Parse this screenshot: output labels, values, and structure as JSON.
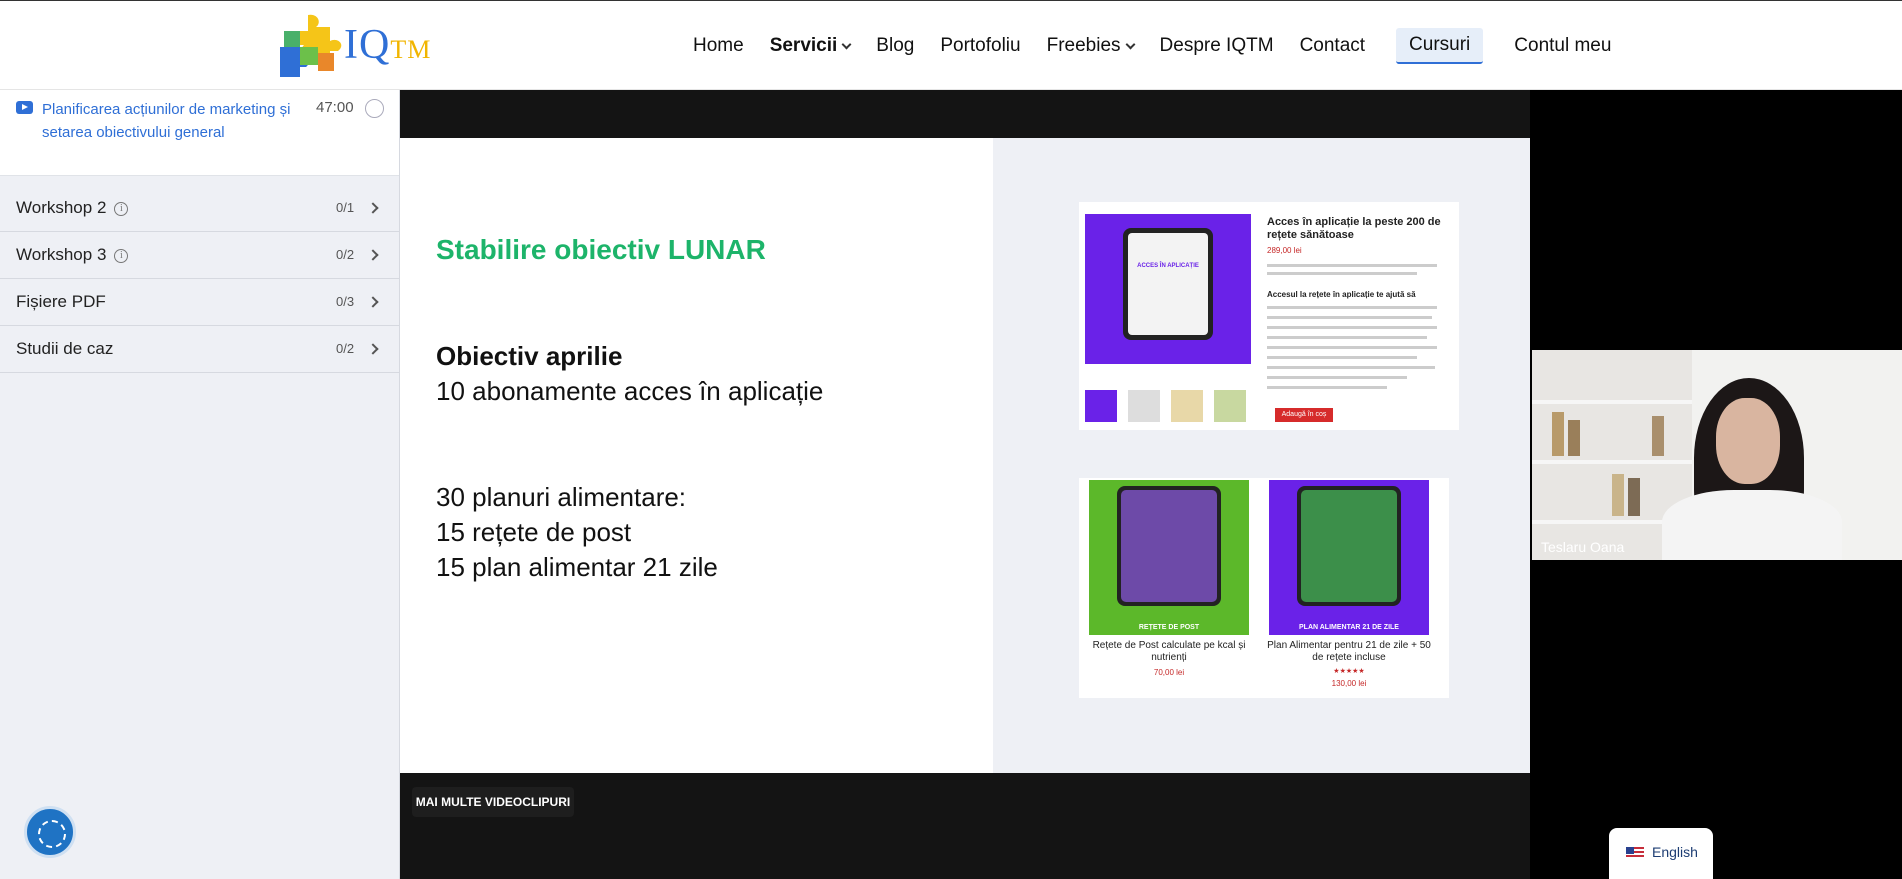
{
  "header": {
    "logo_text": "IQ",
    "logo_tm": "TM",
    "nav": [
      {
        "label": "Home"
      },
      {
        "label": "Servicii"
      },
      {
        "label": "Blog"
      },
      {
        "label": "Portofoliu"
      },
      {
        "label": "Freebies"
      },
      {
        "label": "Despre IQTM"
      },
      {
        "label": "Contact"
      },
      {
        "label": "Cursuri"
      },
      {
        "label": "Contul meu"
      }
    ]
  },
  "sidebar": {
    "current_lesson": {
      "title": "Planificarea acțiunilor de marketing și setarea obiectivului general",
      "duration": "47:00",
      "icon": "play-icon"
    },
    "sections": [
      {
        "title": "Workshop 2",
        "count": "0/1",
        "info": "i"
      },
      {
        "title": "Workshop 3",
        "count": "0/2",
        "info": "i"
      },
      {
        "title": "Fișiere PDF",
        "count": "0/3"
      },
      {
        "title": "Studii de caz",
        "count": "0/2"
      }
    ]
  },
  "slide": {
    "heading": "Stabilire obiectiv LUNAR",
    "goal_title": "Obiectiv aprilie",
    "goal_text": "10 abonamente acces în aplicație",
    "lines": [
      "30 planuri alimentare:",
      "15 rețete de post",
      "15 plan alimentar 21 zile"
    ],
    "product": {
      "title": "Acces în aplicație la peste 200 de rețete sănătoase",
      "price": "289,00 lei",
      "subtitle": "Accesul la rețete în aplicație te ajută să",
      "button": "Adaugă în coș",
      "tablet_label": "ACCES ÎN APLICAȚIE"
    },
    "cards": [
      {
        "label": "REȚETE DE POST",
        "caption": "Rețete de Post calculate pe kcal și nutrienți",
        "price": "70,00 lei"
      },
      {
        "label": "PLAN ALIMENTAR 21 DE ZILE",
        "caption": "Plan Alimentar pentru 21 de zile + 50 de rețete incluse",
        "rating": "★★★★★",
        "price": "130,00 lei"
      }
    ]
  },
  "video": {
    "more_button": "MAI MULTE VIDEOCLIPURI",
    "participant_name": "Teslaru Oana"
  },
  "language": {
    "label": "English"
  },
  "colors": {
    "accent": "#2f6fd6",
    "green": "#1db46a",
    "purple": "#6a22e8"
  }
}
